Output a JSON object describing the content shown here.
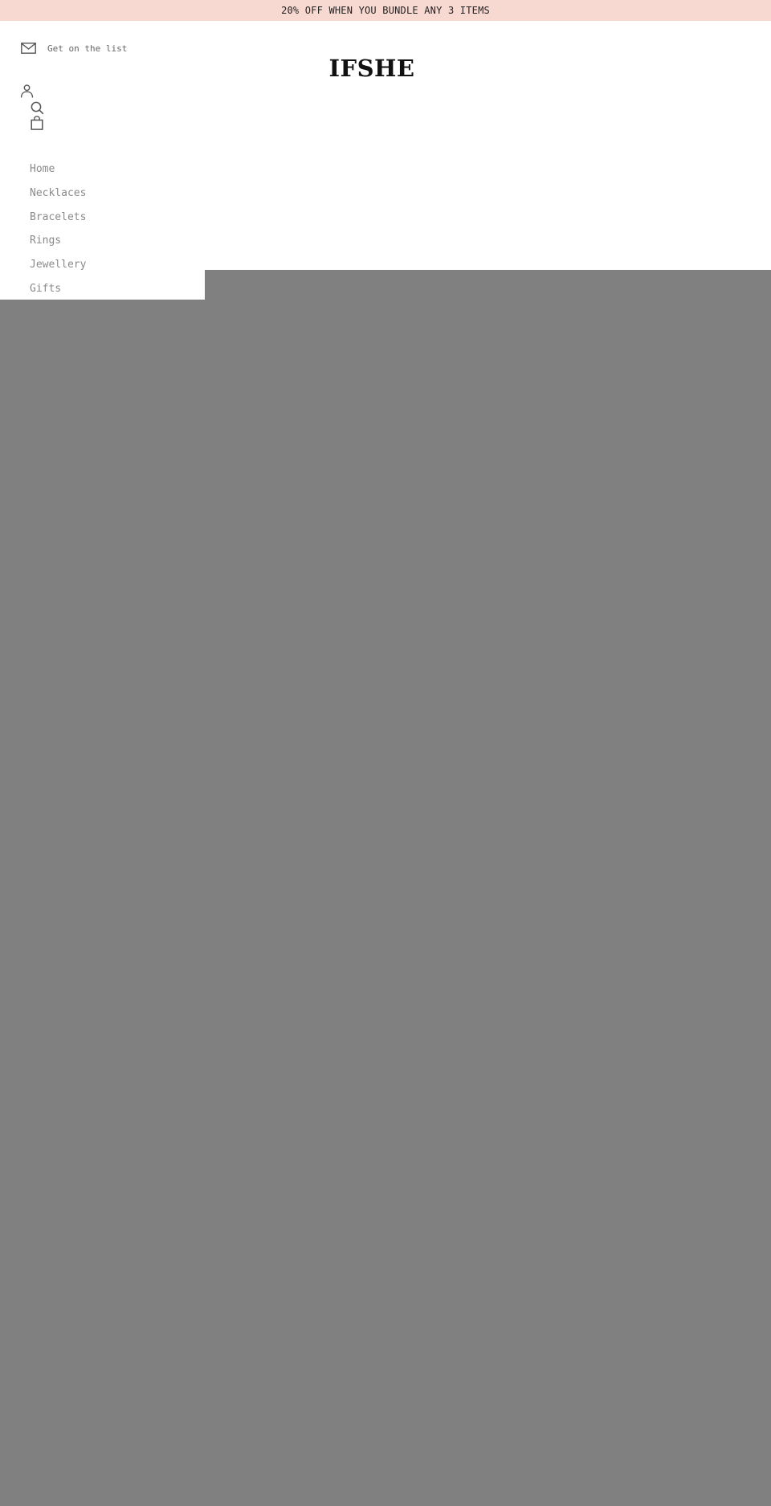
{
  "announcement": {
    "text": "20% OFF WHEN YOU BUNDLE ANY 3 ITEMS"
  },
  "header": {
    "newsletter_label": "Get on the list",
    "logo": "IFSHE",
    "icons": {
      "newsletter": "envelope-icon",
      "account": "user-icon",
      "search": "search-icon",
      "cart": "shopping-bag-icon"
    }
  },
  "nav": {
    "items": [
      {
        "label": "Home"
      },
      {
        "label": "Necklaces"
      },
      {
        "label": "Bracelets"
      },
      {
        "label": "Rings"
      },
      {
        "label": "Jewellery"
      },
      {
        "label": "Gifts"
      }
    ]
  },
  "colors": {
    "announcement_bg": "#f8d9d1",
    "overlay": "#808080",
    "nav_text": "#8a8a8a",
    "logo": "#111111"
  }
}
